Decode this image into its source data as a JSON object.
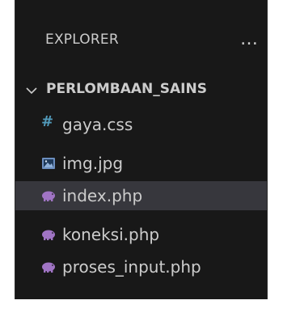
{
  "explorer": {
    "title": "EXPLORER",
    "more_actions": "…"
  },
  "folder": {
    "name": "PERLOMBAAN_SAINS",
    "expanded": true
  },
  "files": [
    {
      "name": "gaya.css",
      "icon": "css-hash-icon",
      "selected": false
    },
    {
      "name": "img.jpg",
      "icon": "image-icon",
      "selected": false
    },
    {
      "name": "index.php",
      "icon": "php-elephant-icon",
      "selected": true
    },
    {
      "name": "koneksi.php",
      "icon": "php-elephant-icon",
      "selected": false
    },
    {
      "name": "proses_input.php",
      "icon": "php-elephant-icon",
      "selected": false
    }
  ],
  "colors": {
    "panel_bg": "#181818",
    "selected_bg": "#37373d",
    "text": "#cccccc",
    "css_icon": "#519aba",
    "php_icon": "#a074c4",
    "image_icon": "#6c8ebf"
  }
}
